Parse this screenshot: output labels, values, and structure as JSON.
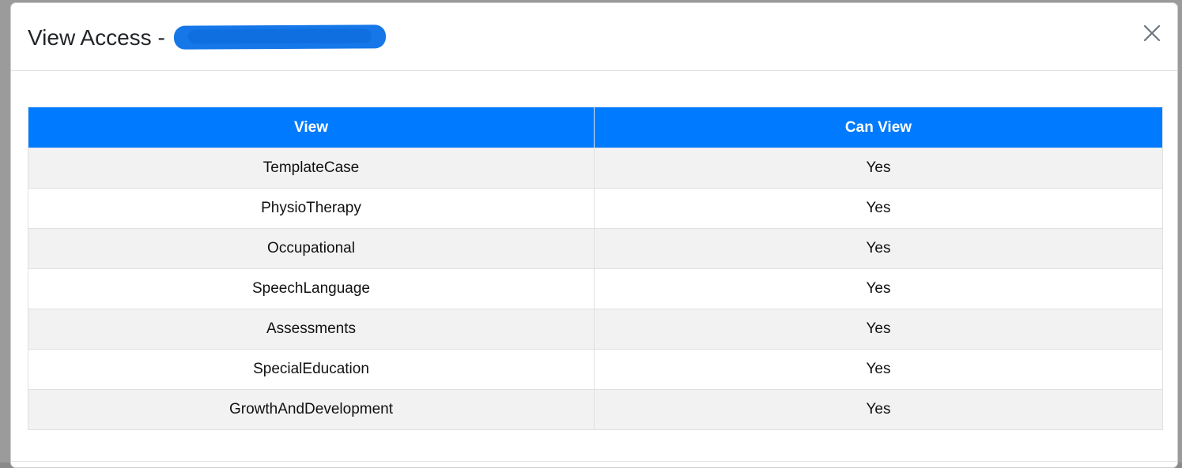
{
  "modal": {
    "title": "View Access - "
  },
  "icons": {
    "close": "close-icon"
  },
  "table": {
    "columns": [
      "View",
      "Can View"
    ],
    "rows": [
      {
        "view": "TemplateCase",
        "can_view": "Yes"
      },
      {
        "view": "PhysioTherapy",
        "can_view": "Yes"
      },
      {
        "view": "Occupational",
        "can_view": "Yes"
      },
      {
        "view": "SpeechLanguage",
        "can_view": "Yes"
      },
      {
        "view": "Assessments",
        "can_view": "Yes"
      },
      {
        "view": "SpecialEducation",
        "can_view": "Yes"
      },
      {
        "view": "GrowthAndDevelopment",
        "can_view": "Yes"
      }
    ]
  },
  "colors": {
    "header_bg": "#007bff",
    "stripe": "#f2f2f2",
    "redaction": "#1577e8"
  }
}
